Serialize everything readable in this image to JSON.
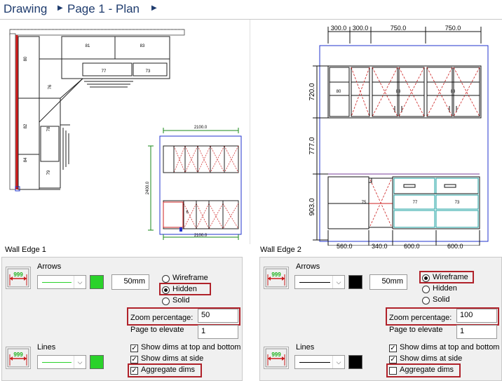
{
  "breadcrumb": {
    "items": [
      "Drawing",
      "Page 1 - Plan"
    ]
  },
  "left_view": {
    "title": "Wall Edge 1",
    "plan_labels": [
      "80",
      "81",
      "83",
      "77",
      "73",
      "76",
      "82",
      "78",
      "84",
      "79"
    ],
    "elev_dims": {
      "width": "2100.0",
      "height": "2400.0",
      "bottom": "2100.0"
    },
    "elev_labels": [
      "6"
    ]
  },
  "right_view": {
    "title": "Wall  Edge 2",
    "top_dims": [
      "300.0",
      "300.0",
      "750.0",
      "750.0"
    ],
    "side_dims": [
      "720.0",
      "777.0",
      "903.0"
    ],
    "bottom_dims": [
      "560.0",
      "340.0",
      "600.0",
      "600.0"
    ],
    "cabinet_labels": [
      "80",
      "83",
      "83",
      "75",
      "77",
      "73"
    ]
  },
  "panels": [
    {
      "arrows_label": "Arrows",
      "arrow_size": "50mm",
      "arrow_color": "#2ad22a",
      "render_modes": [
        "Wireframe",
        "Hidden",
        "Solid"
      ],
      "selected_mode": "Hidden",
      "zoom_label": "Zoom percentage:",
      "zoom_value": "50",
      "page_label": "Page to elevate",
      "page_value": "1",
      "lines_label": "Lines",
      "line_color": "#2ad22a",
      "checks": [
        {
          "label": "Show dims at top and bottom",
          "checked": true
        },
        {
          "label": "Show dims at side",
          "checked": true
        },
        {
          "label": "Aggregate dims",
          "checked": true
        }
      ],
      "dim_icon_text": "999"
    },
    {
      "arrows_label": "Arrows",
      "arrow_size": "50mm",
      "arrow_color": "#000000",
      "render_modes": [
        "Wireframe",
        "Hidden",
        "Solid"
      ],
      "selected_mode": "Wireframe",
      "zoom_label": "Zoom percentage:",
      "zoom_value": "100",
      "page_label": "Page to elevate",
      "page_value": "1",
      "lines_label": "Lines",
      "line_color": "#000000",
      "checks": [
        {
          "label": "Show dims at top and bottom",
          "checked": true
        },
        {
          "label": "Show dims at side",
          "checked": true
        },
        {
          "label": "Aggregate dims",
          "checked": false
        }
      ],
      "dim_icon_text": "999"
    }
  ]
}
